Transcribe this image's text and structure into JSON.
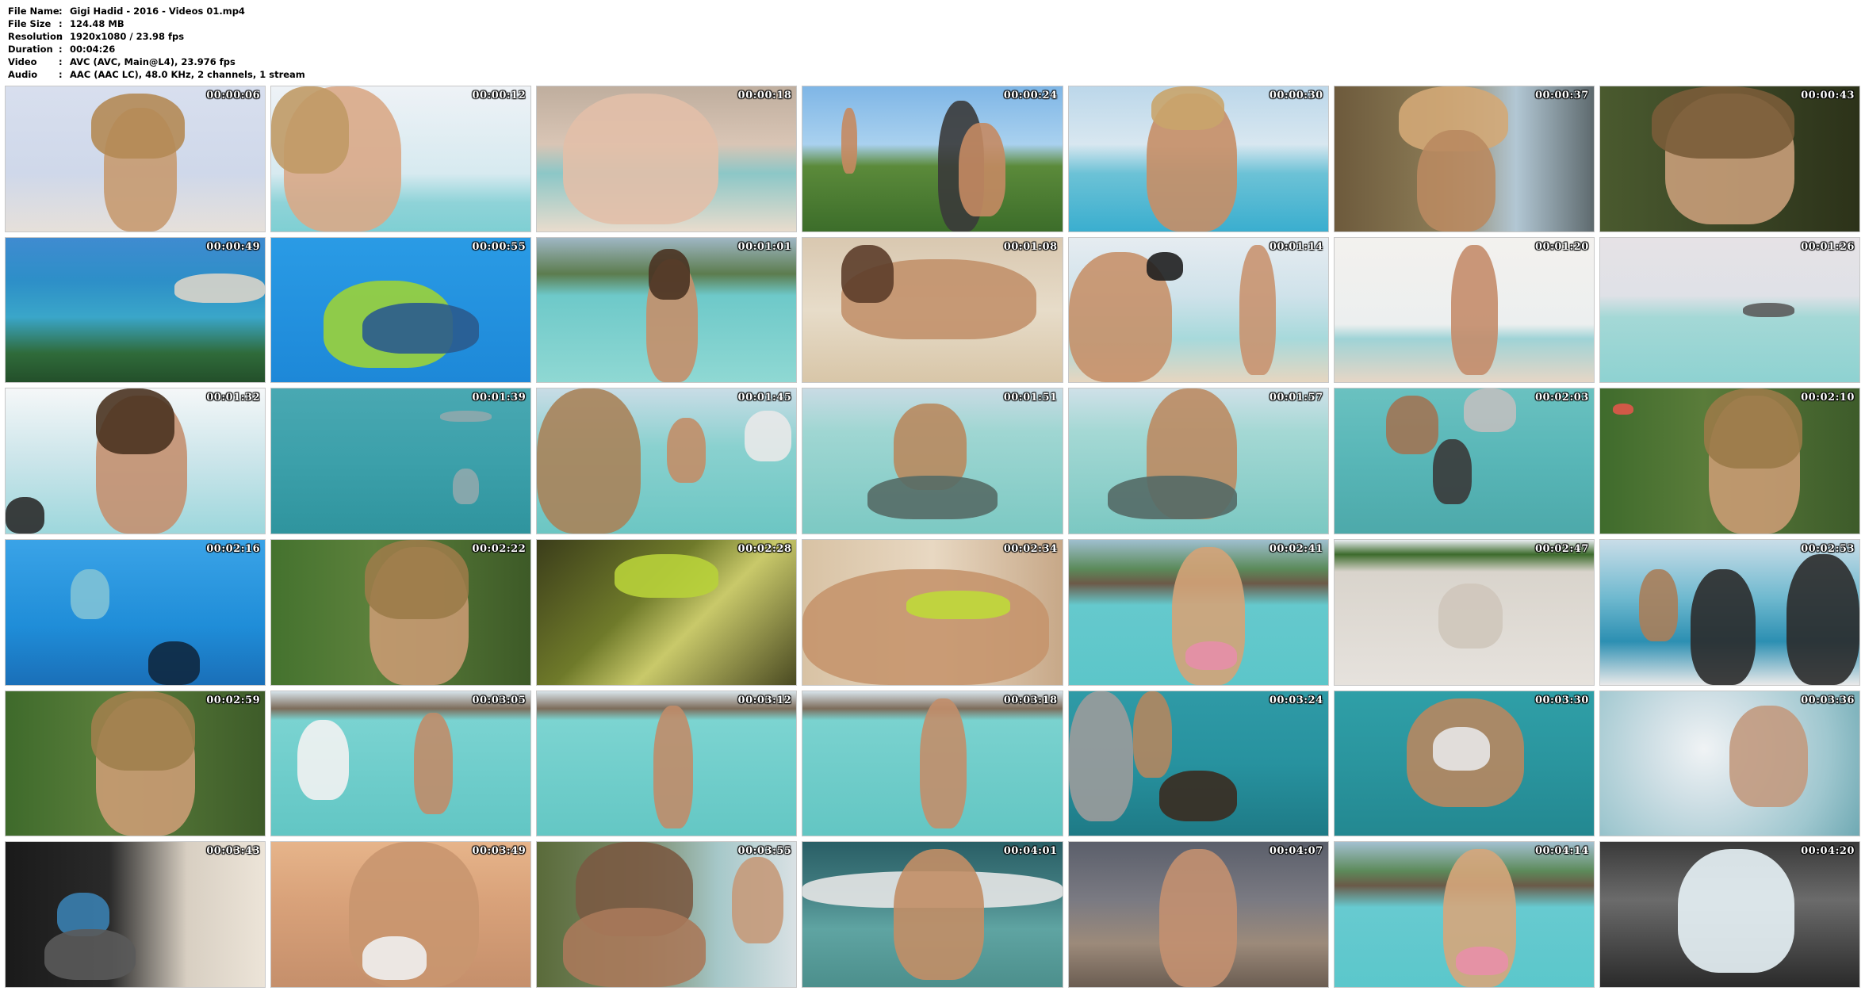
{
  "info": {
    "rows": [
      {
        "key": "File Name",
        "value": "Gigi Hadid - 2016 - Videos 01.mp4"
      },
      {
        "key": "File Size",
        "value": "124.48 MB"
      },
      {
        "key": "Resolution",
        "value": "1920x1080 / 23.98 fps"
      },
      {
        "key": "Duration",
        "value": "00:04:26"
      },
      {
        "key": "Video",
        "value": "AVC (AVC, Main@L4), 23.976 fps"
      },
      {
        "key": "Audio",
        "value": "AAC (AAC LC), 48.0 KHz, 2 channels, 1 stream"
      }
    ]
  },
  "thumbnails": [
    {
      "time": "00:00:06",
      "scene": "portrait-sky"
    },
    {
      "time": "00:00:12",
      "scene": "portrait-beach"
    },
    {
      "time": "00:00:18",
      "scene": "beach-overlay"
    },
    {
      "time": "00:00:24",
      "scene": "photoshoot-hill"
    },
    {
      "time": "00:00:30",
      "scene": "lagoon-pose"
    },
    {
      "time": "00:00:37",
      "scene": "tree-portrait"
    },
    {
      "time": "00:00:43",
      "scene": "closeup-dark"
    },
    {
      "time": "00:00:49",
      "scene": "lagoon-aerial"
    },
    {
      "time": "00:00:55",
      "scene": "underwater-fish"
    },
    {
      "time": "00:01:01",
      "scene": "lagoon-mountain"
    },
    {
      "time": "00:01:08",
      "scene": "sand-lying"
    },
    {
      "time": "00:01:14",
      "scene": "photographer-beach"
    },
    {
      "time": "00:01:20",
      "scene": "beach-back"
    },
    {
      "time": "00:01:26",
      "scene": "lagoon-boat"
    },
    {
      "time": "00:01:32",
      "scene": "boat-interview"
    },
    {
      "time": "00:01:39",
      "scene": "underwater-sharks"
    },
    {
      "time": "00:01:45",
      "scene": "behind-scenes-water"
    },
    {
      "time": "00:01:51",
      "scene": "water-stingray"
    },
    {
      "time": "00:01:57",
      "scene": "water-stingray-2"
    },
    {
      "time": "00:02:03",
      "scene": "water-crew"
    },
    {
      "time": "00:02:10",
      "scene": "garden-interview"
    },
    {
      "time": "00:02:16",
      "scene": "underwater-diver"
    },
    {
      "time": "00:02:22",
      "scene": "garden-interview-2"
    },
    {
      "time": "00:02:28",
      "scene": "blurry-green"
    },
    {
      "time": "00:02:34",
      "scene": "closeup-sunlit"
    },
    {
      "time": "00:02:41",
      "scene": "overwater-bungalows"
    },
    {
      "time": "00:02:47",
      "scene": "hermit-crab-sand"
    },
    {
      "time": "00:02:53",
      "scene": "boat-crew"
    },
    {
      "time": "00:02:59",
      "scene": "garden-interview-3"
    },
    {
      "time": "00:03:05",
      "scene": "lagoon-photographer"
    },
    {
      "time": "00:03:12",
      "scene": "lagoon-standing"
    },
    {
      "time": "00:03:18",
      "scene": "lagoon-standing-2"
    },
    {
      "time": "00:03:24",
      "scene": "dock-pose"
    },
    {
      "time": "00:03:30",
      "scene": "water-pose-teal"
    },
    {
      "time": "00:03:36",
      "scene": "water-ripples"
    },
    {
      "time": "00:03:43",
      "scene": "laptop-set"
    },
    {
      "time": "00:03:49",
      "scene": "closeup-sunset"
    },
    {
      "time": "00:03:55",
      "scene": "photographer-closeup"
    },
    {
      "time": "00:04:01",
      "scene": "canoe-pose"
    },
    {
      "time": "00:04:07",
      "scene": "dusk-beach"
    },
    {
      "time": "00:04:14",
      "scene": "overwater-bungalows-2"
    },
    {
      "time": "00:04:20",
      "scene": "logo-outro"
    }
  ],
  "colors": {
    "sky": "#c9d6e6",
    "lagoon": "#5cc6c9",
    "deep_water": "#1e9bd1",
    "sand": "#e9d8bf",
    "skin": "#c08a66",
    "hair": "#a07a4a",
    "foliage": "#3d6b2c",
    "dark": "#1b1b1b",
    "timestamp": "#ffffff"
  }
}
